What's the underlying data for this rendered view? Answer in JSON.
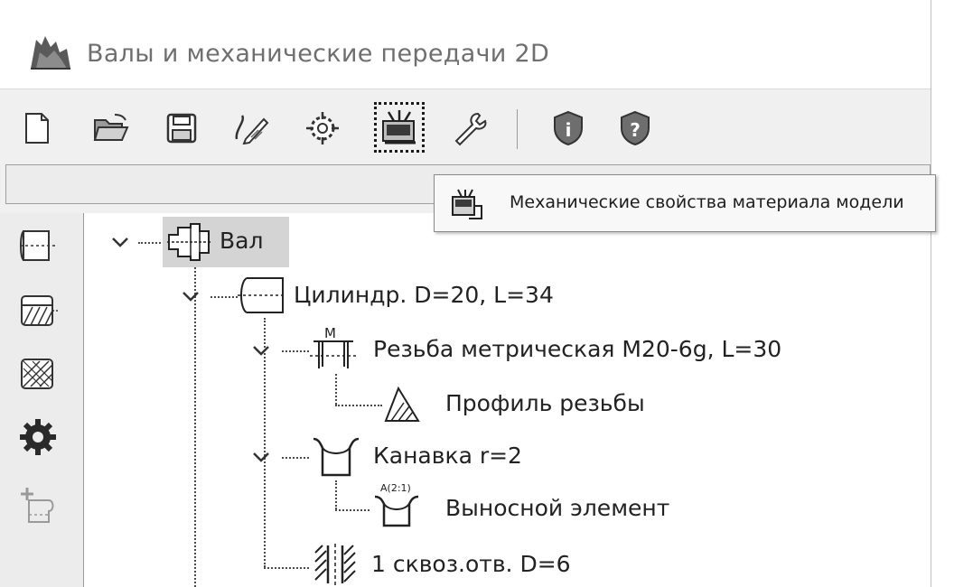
{
  "window": {
    "title": "Валы и механические передачи 2D"
  },
  "toolbar": {
    "buttons": [
      {
        "icon": "new-document-icon"
      },
      {
        "icon": "open-folder-icon"
      },
      {
        "icon": "save-disk-icon"
      },
      {
        "icon": "edit-pen-icon"
      },
      {
        "icon": "gear-calc-icon"
      },
      {
        "icon": "material-properties-icon"
      },
      {
        "icon": "wrench-settings-icon"
      },
      {
        "icon": "info-shield-icon"
      },
      {
        "icon": "help-shield-icon"
      }
    ]
  },
  "tooltip": {
    "text": "Механические свойства материала модели"
  },
  "sidebar": {
    "buttons": [
      {
        "icon": "cylinder-section-icon"
      },
      {
        "icon": "hatched-section-icon"
      },
      {
        "icon": "crosshatch-section-icon"
      },
      {
        "icon": "gear-wheel-icon"
      },
      {
        "icon": "add-element-icon"
      }
    ]
  },
  "tree": {
    "nodes": [
      {
        "label": "Вал",
        "level": 0,
        "expanded": true,
        "selected": true
      },
      {
        "label": "Цилиндр. D=20, L=34",
        "level": 1,
        "expanded": true
      },
      {
        "label": "Резьба метрическая М20-6g, L=30",
        "level": 2,
        "expanded": true
      },
      {
        "label": "Профиль резьбы",
        "level": 3
      },
      {
        "label": "Канавка r=2",
        "level": 2,
        "expanded": true
      },
      {
        "label": "Выносной элемент",
        "level": 3
      },
      {
        "label": "1 сквоз.отв. D=6",
        "level": 2
      }
    ]
  },
  "colors": {
    "tree_selection": "#d4d4d4",
    "window_bg": "#f0f0f0",
    "tooltip_bg": "#f8f8f8"
  }
}
